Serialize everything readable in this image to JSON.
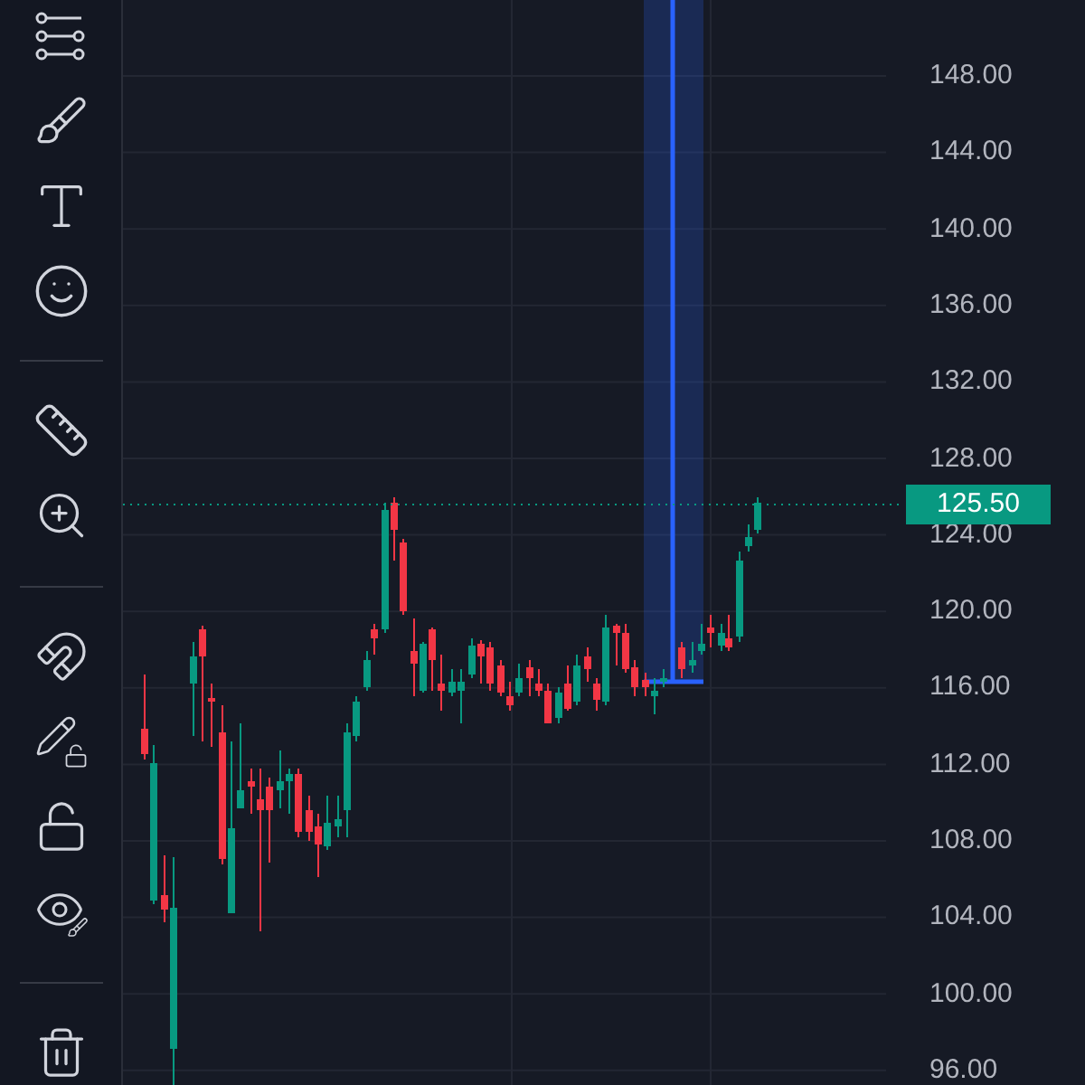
{
  "price_axis": {
    "labels": [
      "148.00",
      "144.00",
      "140.00",
      "136.00",
      "132.00",
      "128.00",
      "124.00",
      "120.00",
      "116.00",
      "112.00",
      "108.00",
      "104.00",
      "100.00",
      "96.00"
    ]
  },
  "last_price": {
    "label": "125.50"
  }
}
